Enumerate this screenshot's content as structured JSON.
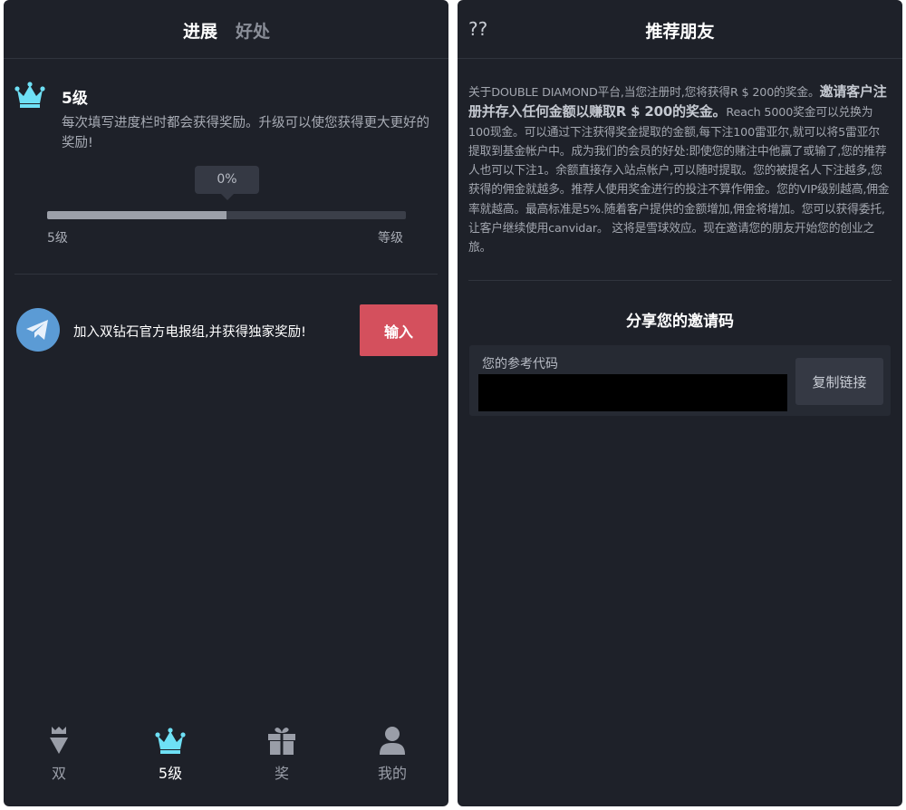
{
  "left": {
    "tabs": [
      {
        "label": "进展"
      },
      {
        "label": "好处"
      }
    ],
    "level": {
      "title": "5级",
      "description": "每次填写进度栏时都会获得奖励。升级可以使您获得更大更好的奖励!",
      "progress_text": "0%",
      "progress_fill": 0.5,
      "start_label": "5级",
      "end_label": "等级"
    },
    "telegram": {
      "text": "加入双钻石官方电报组,并获得独家奖励!",
      "button_label": "输入"
    },
    "bottom_nav": [
      {
        "label": "双",
        "icon": "diamond-icon"
      },
      {
        "label": "5级",
        "icon": "crown-icon"
      },
      {
        "label": "奖",
        "icon": "gift-icon"
      },
      {
        "label": "我的",
        "icon": "user-icon"
      }
    ],
    "colors": {
      "accent": "#6ee0f5",
      "button": "#d4505d",
      "background": "#1e2129"
    }
  },
  "right": {
    "header": {
      "back": "??",
      "title": "推荐朋友"
    },
    "intro": {
      "p1": "关于DOUBLE DIAMOND平台,当您注册时,您将获得R $ 200的奖金。",
      "p2": "邀请客户注册并存入任何金额以赚取R $ 200的奖金。",
      "p3": "Reach 5000奖金可以兑换为100现金。可以通过下注获得奖金提取的金额,每下注100雷亚尔,就可以将5雷亚尔提取到基金帐户中。成为我们的会员的好处:即使您的赌注中他赢了或输了,您的推荐人也可以下注1。余额直接存入站点帐户,可以随时提取。您的被提名人下注越多,您获得的佣金就越多。推荐人使用奖金进行的投注不算作佣金。您的VIP级别越高,佣金率就越高。最高标准是5%.随着客户提供的金额增加,佣金将增加。您可以获得委托,让客户继续使用canvidar。 这将是雪球效应。现在邀请您的朋友开始您的创业之旅。"
    },
    "share": {
      "title": "分享您的邀请码",
      "ref_label": "您的参考代码",
      "copy_label": "复制链接"
    }
  }
}
